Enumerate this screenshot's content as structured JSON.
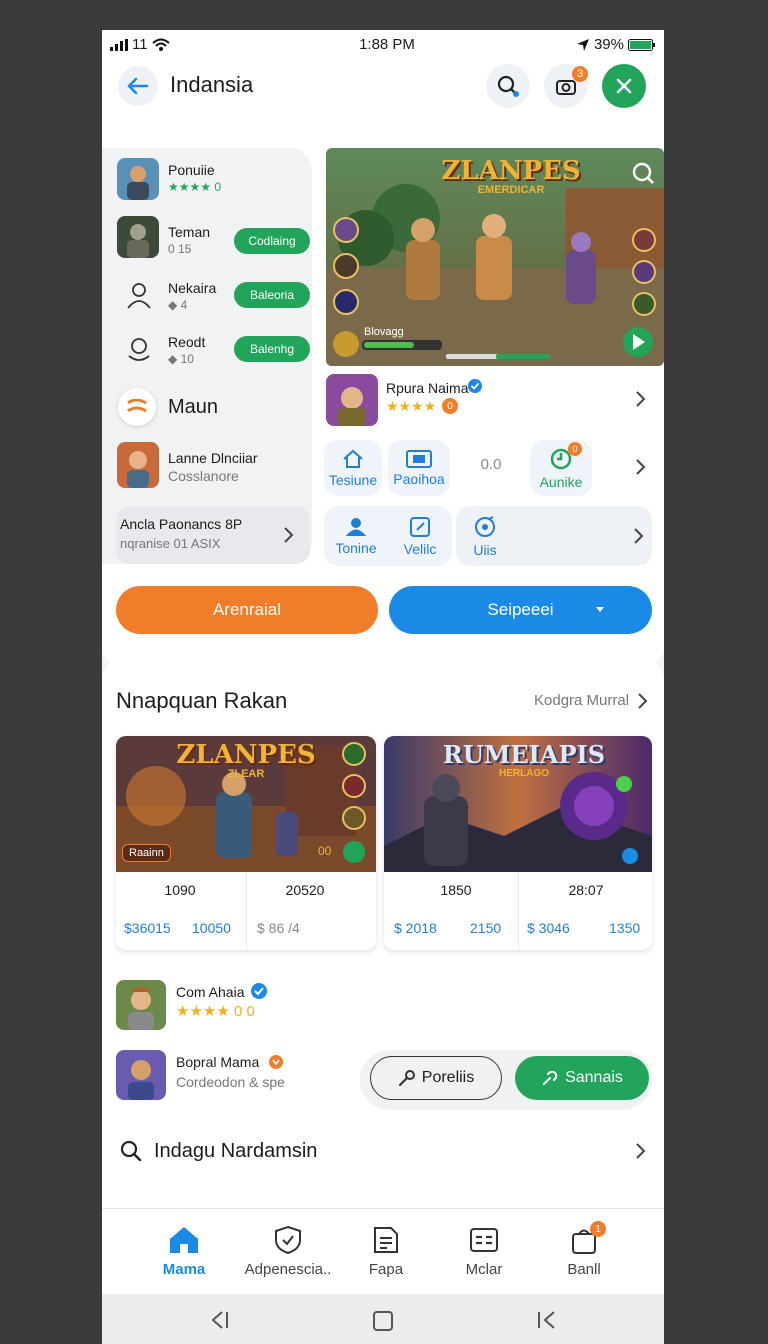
{
  "status": {
    "signal": "11",
    "time": "1:88 PM",
    "battery": "39%"
  },
  "header": {
    "title": "Indansia",
    "notif_count": "3"
  },
  "friends": [
    {
      "name": "Ponuiie",
      "meta": "★★★★ 0"
    },
    {
      "name": "Teman",
      "meta": "0 15",
      "action": "Codlaing"
    },
    {
      "name": "Nekaira",
      "meta": "◆ 4",
      "action": "Baleoria"
    },
    {
      "name": "Reodt",
      "meta": "◆ 10",
      "action": "Balenhg"
    }
  ],
  "maun": {
    "label": "Maun"
  },
  "profile": {
    "name": "Lanne Dlnciiar",
    "sub": "Cosslanore"
  },
  "promo": {
    "line1": "Ancla Paonancs 8P",
    "line2": "nqranise 01 ASIX"
  },
  "hero": {
    "title_line1": "ZLANPES",
    "title_line2": "EMERDICAR",
    "level": "Blovagg"
  },
  "featured": {
    "name": "Rpura Naima",
    "stars": "★★★★",
    "badge": "0"
  },
  "tiles_row1": [
    {
      "label": "Tesiune",
      "icon": "house-icon"
    },
    {
      "label": "Paoihoa",
      "icon": "card-icon"
    },
    {
      "label": "0.0",
      "icon": ""
    },
    {
      "label": "Aunike",
      "icon": "refresh-icon",
      "badge": "0"
    }
  ],
  "tiles_row2": [
    {
      "label": "Tonine",
      "icon": "person-icon"
    },
    {
      "label": "Velilc",
      "icon": "edit-icon"
    },
    {
      "label": "Uiis",
      "icon": "target-icon"
    }
  ],
  "buttons": {
    "orange": "Arenraial",
    "blue": "Seipeeei"
  },
  "section": {
    "title": "Nnapquan Rakan",
    "link": "Kodgra Murral"
  },
  "cards": [
    {
      "title": "ZLANPES",
      "subtitle": "ZLEAR",
      "tag": "Raainn",
      "tag_right": "00",
      "cols": [
        {
          "num": "1090",
          "left": "$36015",
          "right": "10050"
        },
        {
          "num": "20520",
          "left": "$ 86 /4",
          "right": ""
        }
      ]
    },
    {
      "title": "RUMEIAPIS",
      "subtitle": "HERLAGO",
      "tag": "",
      "tag_right": "",
      "cols": [
        {
          "num": "1850",
          "left": "$ 2018",
          "right": "2150"
        },
        {
          "num": "28:07",
          "left": "$ 3046",
          "right": "1350"
        }
      ]
    }
  ],
  "players": [
    {
      "name": "Com Ahaia",
      "sub": "★★★★ 0 0"
    },
    {
      "name": "Bopral Mama",
      "sub": "Cordeodon & spe"
    }
  ],
  "action_buttons": {
    "outline": "Poreliis",
    "green": "Sannais"
  },
  "search_row": {
    "label": "Indagu Nardamsin"
  },
  "nav": [
    {
      "label": "Mama",
      "icon": "home-icon"
    },
    {
      "label": "Adpenescia..",
      "icon": "shield-icon"
    },
    {
      "label": "Fapa",
      "icon": "document-icon"
    },
    {
      "label": "Mclar",
      "icon": "grid-icon"
    },
    {
      "label": "Banll",
      "icon": "bag-icon",
      "badge": "1"
    }
  ],
  "colors": {
    "orange": "#ef7d2a",
    "blue": "#1a8ae6",
    "green": "#22a55a",
    "link_blue": "#1f7fd6"
  }
}
